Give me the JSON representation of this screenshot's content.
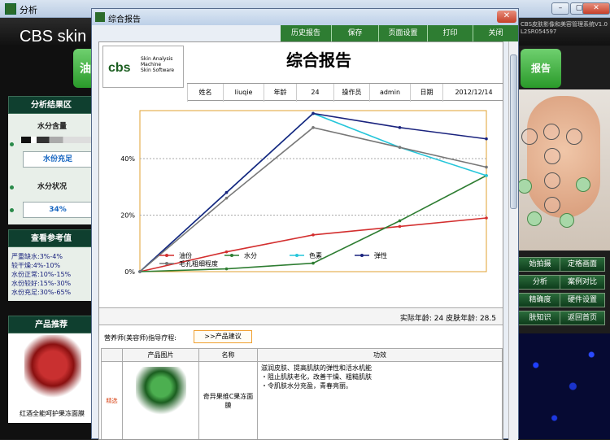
{
  "background_window": {
    "title": "分析",
    "brand": "CBS skin c",
    "version_text": "CBS皮肤影像和美容管理系统V1.0 L2SR054597",
    "left_green_button": "油",
    "right_green_button": "报告",
    "min_glyph": "–",
    "max_glyph": "▢",
    "close_glyph": "✕"
  },
  "left_panel": {
    "analysis_header": "分析结果区",
    "moisture_title": "水分含量",
    "moisture_value": "水份充足",
    "moisture_status_title": "水分状况",
    "moisture_percent": "34%",
    "reference_header": "查看参考值",
    "reference_items": [
      "严重缺水:3%-4%",
      "较干燥:4%-10%",
      "水份正常:10%-15%",
      "水份较好:15%-30%",
      "水份充足:30%-65%"
    ],
    "product_header": "产品推荐",
    "product_name": "红酒全能呵护果冻面膜"
  },
  "right_panel": {
    "buttons": [
      "始拍摄",
      "定格画面",
      "分析",
      "案例对比",
      "精确度",
      "硬件设置",
      "肤知识",
      "返回首页"
    ]
  },
  "dialog": {
    "title": "综合报告",
    "close_glyph": "✕",
    "toolbar": [
      "历史报告",
      "保存",
      "页面设置",
      "打印",
      "关闭"
    ],
    "report_title": "综合报告",
    "logo": {
      "cbs": "cbs",
      "sub1": "Skin Analysis",
      "sub2": "Machine",
      "sub3": "Skin Software"
    },
    "info": {
      "name_label": "姓名",
      "name": "liuqie",
      "age_label": "年龄",
      "age": "24",
      "operator_label": "操作员",
      "operator": "admin",
      "date_label": "日期",
      "date": "2012/12/14"
    },
    "actual_age_text": "实际年龄: 24  皮肤年龄: 28.5",
    "advisor_text": "营养师(美容师)指导疗程:",
    "advice_button": ">>产品建议",
    "product_table": {
      "headers": [
        "",
        "产品图片",
        "名称",
        "功效"
      ],
      "row": {
        "tag": "精选",
        "name": "奇异果维C果冻面膜",
        "effect": "滋润皮肤、提高肌肤的弹性和活水机能\n・阻止肌肤老化，改善干燥、粗糙肌肤\n・令肌肤水分充盈，青春亮丽。"
      }
    }
  },
  "chart_data": {
    "type": "line",
    "x": [
      0,
      1,
      2,
      3,
      4
    ],
    "ylim": [
      0,
      57
    ],
    "yticks": [
      "0%",
      "20%",
      "40%"
    ],
    "series": [
      {
        "name": "油份",
        "color": "#d32f2f",
        "values": [
          0,
          7,
          13,
          16,
          19
        ]
      },
      {
        "name": "水分",
        "color": "#2e7d32",
        "values": [
          0,
          1,
          3,
          18,
          34
        ]
      },
      {
        "name": "色素",
        "color": "#26c6da",
        "values": [
          0,
          28,
          56,
          44,
          34
        ]
      },
      {
        "name": "弹性",
        "color": "#1a237e",
        "values": [
          0,
          28,
          56,
          51,
          47
        ]
      },
      {
        "name": "毛孔粗细程度",
        "color": "#777777",
        "values": [
          0,
          26,
          51,
          44,
          37
        ]
      }
    ],
    "legend_position": "bottom",
    "grid": true
  }
}
